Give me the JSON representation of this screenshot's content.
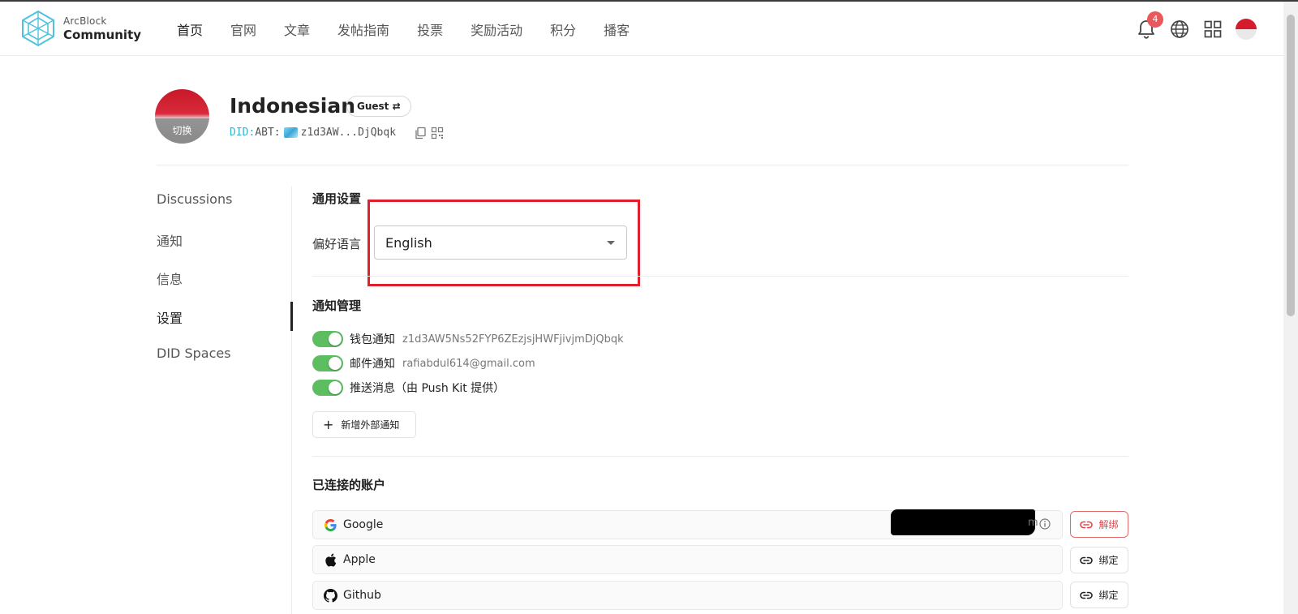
{
  "header": {
    "logo_line1": "ArcBlock",
    "logo_line2": "Community",
    "nav": [
      "首页",
      "官网",
      "文章",
      "发帖指南",
      "投票",
      "奖励活动",
      "积分",
      "播客"
    ],
    "notification_count": "4"
  },
  "profile": {
    "name": "Indonesian",
    "role_badge": "Guest ⇄",
    "avatar_switch_label": "切换",
    "did_prefix": "DID:",
    "did_type": "ABT:",
    "did_value": "z1d3AW...DjQbqk"
  },
  "sidebar": {
    "items": [
      "Discussions",
      "通知",
      "信息",
      "设置",
      "DID Spaces"
    ],
    "active": "设置"
  },
  "general_settings": {
    "title": "通用设置",
    "language_label": "偏好语言",
    "language_value": "English"
  },
  "notification_settings": {
    "title": "通知管理",
    "rows": [
      {
        "label": "钱包通知",
        "value": "z1d3AW5Ns52FYP6ZEzjsjHWFjivjmDjQbqk",
        "enabled": true
      },
      {
        "label": "邮件通知",
        "value": "rafiabdul614@gmail.com",
        "enabled": true
      },
      {
        "label": "推送消息（由 Push Kit 提供）",
        "value": "",
        "enabled": true
      }
    ],
    "add_button": "新增外部通知"
  },
  "connected_accounts": {
    "title": "已连接的账户",
    "accounts": [
      {
        "name": "Google",
        "tail": "m",
        "action": "解绑",
        "linked": true
      },
      {
        "name": "Apple",
        "tail": "",
        "action": "绑定",
        "linked": false
      },
      {
        "name": "Github",
        "tail": "",
        "action": "绑定",
        "linked": false
      }
    ]
  },
  "colors": {
    "toggle_on": "#5dbd61",
    "highlight_box": "#e0202d",
    "did_accent": "#36b3d1",
    "unlink_red": "#e0474c"
  }
}
